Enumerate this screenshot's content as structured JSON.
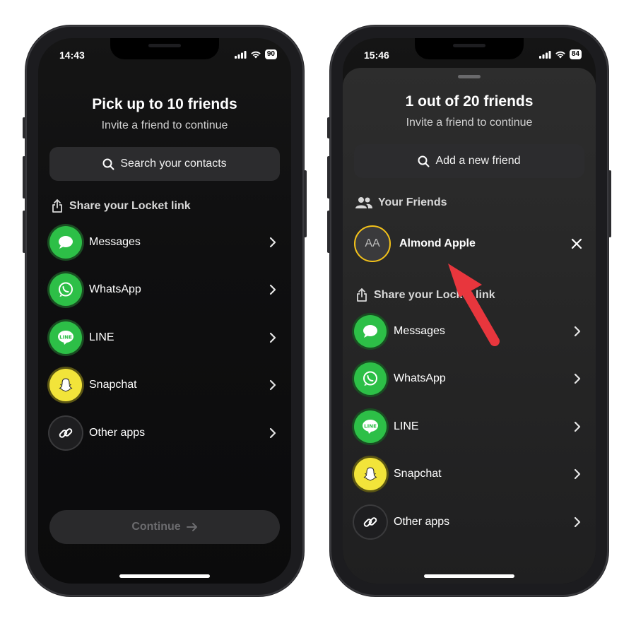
{
  "left": {
    "time": "14:43",
    "battery": "90",
    "title": "Pick up to 10 friends",
    "subtitle": "Invite a friend to continue",
    "search_label": "Search your contacts",
    "share_label": "Share your Locket link",
    "apps": [
      {
        "label": "Messages",
        "icon": "messages-icon"
      },
      {
        "label": "WhatsApp",
        "icon": "whatsapp-icon"
      },
      {
        "label": "LINE",
        "icon": "line-icon"
      },
      {
        "label": "Snapchat",
        "icon": "snapchat-icon"
      },
      {
        "label": "Other apps",
        "icon": "link-icon"
      }
    ],
    "continue_label": "Continue"
  },
  "right": {
    "time": "15:46",
    "battery": "84",
    "title": "1 out of 20 friends",
    "subtitle": "Invite a friend to continue",
    "add_label": "Add a new friend",
    "friends_label": "Your Friends",
    "friends": [
      {
        "initials": "AA",
        "name": "Almond Apple"
      }
    ],
    "share_label": "Share your Locket link",
    "apps": [
      {
        "label": "Messages",
        "icon": "messages-icon"
      },
      {
        "label": "WhatsApp",
        "icon": "whatsapp-icon"
      },
      {
        "label": "LINE",
        "icon": "line-icon"
      },
      {
        "label": "Snapchat",
        "icon": "snapchat-icon"
      },
      {
        "label": "Other apps",
        "icon": "link-icon"
      }
    ]
  },
  "colors": {
    "accent_green": "#2dbf47",
    "snapchat_yellow": "#f2e43a",
    "avatar_ring": "#f3c21a",
    "annotation_arrow": "#e8363d"
  }
}
